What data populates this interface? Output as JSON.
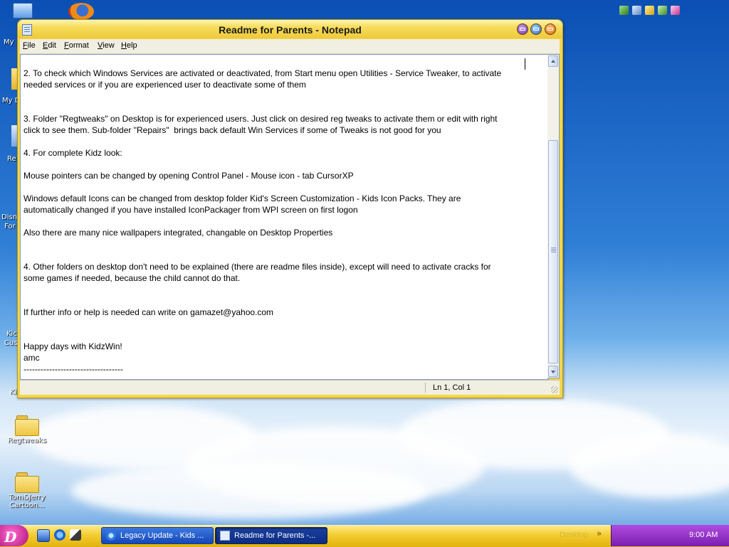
{
  "window": {
    "title": "Readme for Parents - Notepad",
    "menu": {
      "file": {
        "label": "File",
        "access_key": "F",
        "rest": "ile"
      },
      "edit": {
        "label": "Edit",
        "access_key": "E",
        "rest": "dit"
      },
      "format": {
        "label": "Format",
        "access_key": "F",
        "rest": "ormat"
      },
      "view": {
        "label": "View",
        "access_key": "V",
        "rest": "iew"
      },
      "help": {
        "label": "Help",
        "access_key": "H",
        "rest": "elp"
      }
    },
    "content": "2. To check which Windows Services are activated or deactivated, from Start menu open Utilities - Service Tweaker, to activate\nneeded services or if you are experienced user to deactivate some of them\n\n\n3. Folder \"Regtweaks\" on Desktop is for experienced users. Just click on desired reg tweaks to activate them or edit with right\nclick to see them. Sub-folder \"Repairs\"  brings back default Win Services if some of Tweaks is not good for you\n\n4. For complete Kidz look:\n\nMouse pointers can be changed by opening Control Panel - Mouse icon - tab CursorXP\n\nWindows default Icons can be changed from desktop folder Kid's Screen Customization - Kids Icon Packs. They are\nautomatically changed if you have installed IconPackager from WPI screen on first logon\n\nAlso there are many nice wallpapers integrated, changable on Desktop Properties\n\n\n4. Other folders on desktop don't need to be explained (there are readme files inside), except will need to activate cracks for\nsome games if needed, because the child cannot do that.\n\n\nIf further info or help is needed can write on gamazet@yahoo.com\n\n\nHappy days with KidzWin!\namc\n-----------------------------------",
    "status": "Ln 1, Col 1"
  },
  "desktop": {
    "icons": [
      {
        "label": "Regtweaks"
      },
      {
        "label": "Tom&Jerry Cartoon..."
      }
    ],
    "partial_labels": [
      "My",
      "My D",
      "Re",
      "Disn",
      "For",
      "Kic",
      "Cus",
      "Ki"
    ]
  },
  "taskbar": {
    "tasks": [
      {
        "label": "Legacy Update - Kids ..."
      },
      {
        "label": "Readme for Parents -..."
      }
    ],
    "desktop_toolbar": "Desktop",
    "clock": "9:00 AM"
  },
  "colors": {
    "window_frame": "#f4d64a",
    "taskbar": "#f2cc2d",
    "tray": "#9a36d0",
    "start": "#d21c9c"
  }
}
